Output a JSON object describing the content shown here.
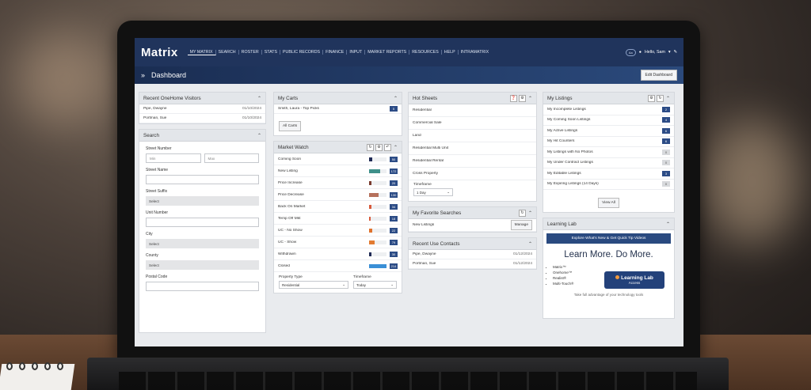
{
  "app": {
    "logo": "Matrix"
  },
  "nav": [
    "MY MATRIX",
    "SEARCH",
    "ROSTER",
    "STATS",
    "PUBLIC RECORDS",
    "FINANCE",
    "INPUT",
    "MARKET REPORTS",
    "RESOURCES",
    "HELP",
    "INTRAMATRIX"
  ],
  "user": {
    "badge": "Aa",
    "greeting": "Hello, Sam"
  },
  "dashboard": {
    "title": "Dashboard",
    "edit_label": "Edit Dashboard"
  },
  "visitors": {
    "title": "Recent OneHome Visitors",
    "rows": [
      {
        "name": "Pipe, Dwayne",
        "date": "01/10/2024"
      },
      {
        "name": "Portman, Sue",
        "date": "01/10/2024"
      }
    ]
  },
  "search": {
    "title": "Search",
    "street_number_label": "Street Number",
    "min_placeholder": "Min",
    "max_placeholder": "Max",
    "street_name_label": "Street Name",
    "street_suffix_label": "Street Suffix",
    "street_suffix_value": "Select",
    "unit_number_label": "Unit Number",
    "city_label": "City",
    "city_value": "Select",
    "county_label": "County",
    "county_value": "Select",
    "postal_code_label": "Postal Code"
  },
  "carts": {
    "title": "My Carts",
    "rows": [
      {
        "name": "Smith, Laura - Top Picks",
        "count": "5"
      }
    ],
    "all_label": "All Carts"
  },
  "market_watch": {
    "title": "Market Watch",
    "rows": [
      {
        "label": "Coming Soon",
        "count": "50",
        "color": "#1f2a55",
        "fill": 0.2
      },
      {
        "label": "New Listing",
        "count": "172",
        "color": "#3e8f89",
        "fill": 0.62
      },
      {
        "label": "Price Increase",
        "count": "20",
        "color": "#7a3b2e",
        "fill": 0.12
      },
      {
        "label": "Price Decrease",
        "count": "130",
        "color": "#b6715c",
        "fill": 0.55
      },
      {
        "label": "Back On Market",
        "count": "34",
        "color": "#d85a3b",
        "fill": 0.14
      },
      {
        "label": "Temp Off Mkt",
        "count": "18",
        "color": "#d85a3b",
        "fill": 0.1
      },
      {
        "label": "UC - No Show",
        "count": "22",
        "color": "#e0722d",
        "fill": 0.2
      },
      {
        "label": "UC - Show",
        "count": "79",
        "color": "#e27b32",
        "fill": 0.3
      },
      {
        "label": "Withdrawn",
        "count": "30",
        "color": "#1f2a55",
        "fill": 0.12
      },
      {
        "label": "Closed",
        "count": "214",
        "color": "#3a8fd6",
        "fill": 1.0
      }
    ],
    "property_type_label": "Property Type",
    "property_type_value": "Residential",
    "timeframe_label": "Timeframe",
    "timeframe_value": "Today"
  },
  "hot_sheets": {
    "title": "Hot Sheets",
    "rows": [
      "Residential",
      "Commercial Sale",
      "Land",
      "Residential Multi Unit",
      "Residential Rental",
      "Cross Property"
    ],
    "timeframe_label": "Timeframe",
    "timeframe_value": "1 Day"
  },
  "favorite_searches": {
    "title": "My Favorite Searches",
    "rows": [
      {
        "name": "New Listings",
        "action": "Manage"
      }
    ]
  },
  "contacts": {
    "title": "Recent Use Contacts",
    "rows": [
      {
        "name": "Pipe, Dwayne",
        "date": "01/12/2024"
      },
      {
        "name": "Portman, Sue",
        "date": "01/12/2024"
      }
    ]
  },
  "listings": {
    "title": "My Listings",
    "rows": [
      {
        "label": "My Incomplete Listings",
        "count": "2",
        "active": true
      },
      {
        "label": "My Coming Soon Listings",
        "count": "4",
        "active": true
      },
      {
        "label": "My Active Listings",
        "count": "6",
        "active": true
      },
      {
        "label": "My Hit Counters",
        "count": "6",
        "active": true
      },
      {
        "label": "My Listings with No Photos",
        "count": "0",
        "active": false
      },
      {
        "label": "My Under Contract Listings",
        "count": "0",
        "active": false
      },
      {
        "label": "My Editable Listings",
        "count": "3",
        "active": true
      },
      {
        "label": "My Expiring Listings (14 Days)",
        "count": "0",
        "active": false
      }
    ],
    "view_all_label": "View All"
  },
  "learning_lab": {
    "title": "Learning Lab",
    "banner": "Explore What's New & Get Quick Tip Videos",
    "headline": "Learn More. Do More.",
    "items": [
      "Matrix™",
      "Onehome™",
      "Realist®",
      "Multi-Touch®"
    ],
    "cta": "Learning Lab",
    "cta_sub": "Access",
    "footer": "Take full advantage of your technology tools"
  }
}
